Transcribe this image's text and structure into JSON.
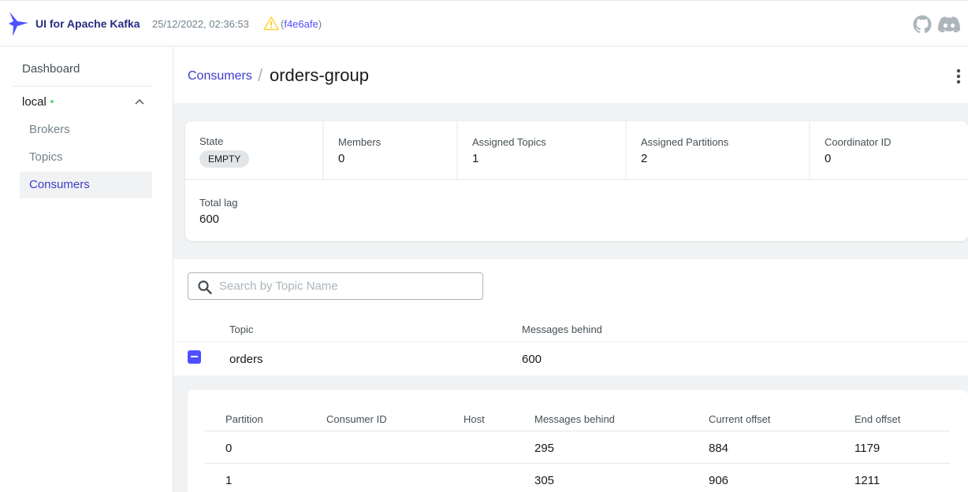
{
  "app": {
    "brand": "UI for Apache Kafka",
    "build_time": "25/12/2022, 02:36:53",
    "commit": "f4e6afe",
    "icons": [
      "logo-icon",
      "warning-icon",
      "github-icon",
      "discord-icon"
    ]
  },
  "sidebar": {
    "dashboard": "Dashboard",
    "cluster": {
      "name": "local",
      "status_color": "#5cd685"
    },
    "items": [
      {
        "label": "Brokers",
        "active": false
      },
      {
        "label": "Topics",
        "active": false
      },
      {
        "label": "Consumers",
        "active": true
      }
    ]
  },
  "breadcrumb": {
    "parent": "Consumers",
    "separator": "/",
    "title": "orders-group"
  },
  "stats": {
    "state": {
      "label": "State",
      "value": "EMPTY"
    },
    "members": {
      "label": "Members",
      "value": "0"
    },
    "assigned_topics": {
      "label": "Assigned Topics",
      "value": "1"
    },
    "assigned_partitions": {
      "label": "Assigned Partitions",
      "value": "2"
    },
    "coordinator_id": {
      "label": "Coordinator ID",
      "value": "0"
    },
    "total_lag": {
      "label": "Total lag",
      "value": "600"
    }
  },
  "search": {
    "placeholder": "Search by Topic Name",
    "value": ""
  },
  "topics_table": {
    "headers": [
      "Topic",
      "Messages behind"
    ],
    "rows": [
      {
        "topic": "orders",
        "messages_behind": "600",
        "expanded": true
      }
    ]
  },
  "partitions_table": {
    "headers": [
      "Partition",
      "Consumer ID",
      "Host",
      "Messages behind",
      "Current offset",
      "End offset"
    ],
    "rows": [
      {
        "partition": "0",
        "consumer_id": "",
        "host": "",
        "messages_behind": "295",
        "current_offset": "884",
        "end_offset": "1179"
      },
      {
        "partition": "1",
        "consumer_id": "",
        "host": "",
        "messages_behind": "305",
        "current_offset": "906",
        "end_offset": "1211"
      }
    ]
  },
  "colors": {
    "accent": "#4f4fff",
    "link": "#3c3ccc",
    "brand": "#2b2b84"
  }
}
